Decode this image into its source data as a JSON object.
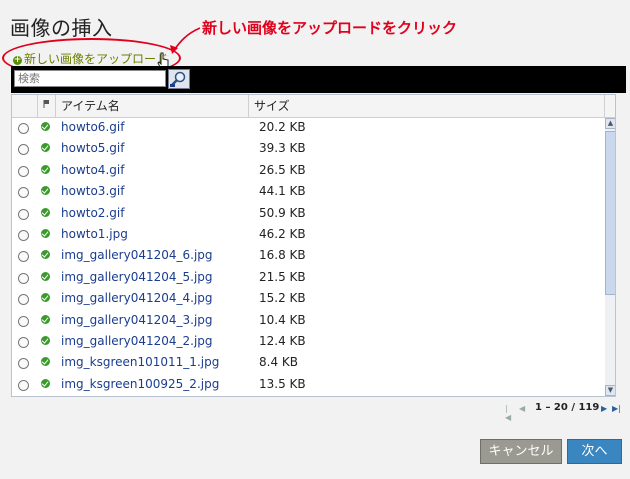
{
  "title": "画像の挿入",
  "annotation": "新しい画像をアップロードをクリック",
  "upload_link": "新しい画像をアップロード",
  "search": {
    "placeholder": "検索",
    "value": ""
  },
  "columns": {
    "flag": "",
    "name": "アイテム名",
    "size": "サイズ"
  },
  "files": [
    {
      "name": "howto6.gif",
      "size": "20.2 KB"
    },
    {
      "name": "howto5.gif",
      "size": "39.3 KB"
    },
    {
      "name": "howto4.gif",
      "size": "26.5 KB"
    },
    {
      "name": "howto3.gif",
      "size": "44.1 KB"
    },
    {
      "name": "howto2.gif",
      "size": "50.9 KB"
    },
    {
      "name": "howto1.jpg",
      "size": "46.2 KB"
    },
    {
      "name": "img_gallery041204_6.jpg",
      "size": "16.8 KB"
    },
    {
      "name": "img_gallery041204_5.jpg",
      "size": "21.5 KB"
    },
    {
      "name": "img_gallery041204_4.jpg",
      "size": "15.2 KB"
    },
    {
      "name": "img_gallery041204_3.jpg",
      "size": "10.4 KB"
    },
    {
      "name": "img_gallery041204_2.jpg",
      "size": "12.4 KB"
    },
    {
      "name": "img_ksgreen101011_1.jpg",
      "size": "8.4 KB"
    },
    {
      "name": "img_ksgreen100925_2.jpg",
      "size": "13.5 KB"
    }
  ],
  "pager": {
    "info": "1 – 20 / 119"
  },
  "buttons": {
    "cancel": "キャンセル",
    "next": "次へ"
  },
  "colors": {
    "annotation": "#e0001c",
    "link": "#6a7f00",
    "file_link": "#1a3d8f",
    "next": "#3a86c0",
    "cancel": "#9a9a92"
  }
}
